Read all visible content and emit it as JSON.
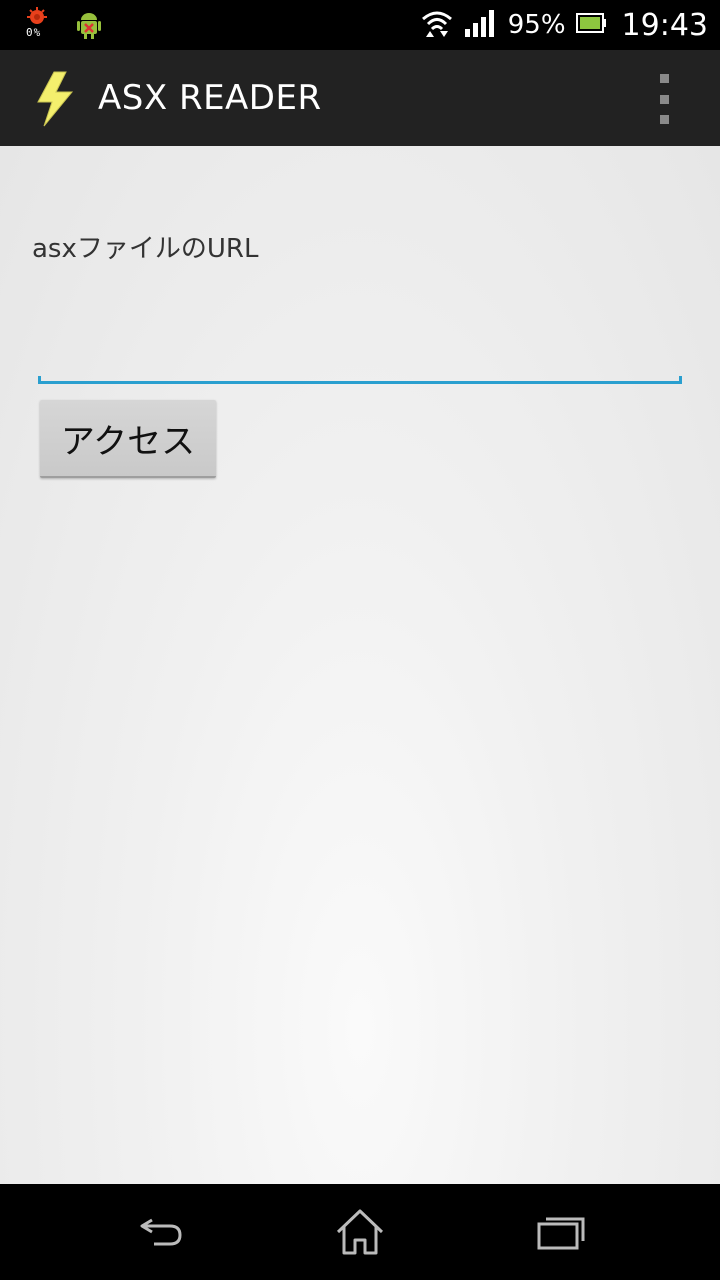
{
  "status_bar": {
    "notification_icons": [
      "download-progress-icon",
      "android-debug-icon"
    ],
    "notification_progress_text": "0%",
    "battery_percent": "95%",
    "time": "19:43",
    "colors": {
      "battery_fill": "#8dc63f",
      "notif_red": "#e8401c",
      "notif_green": "#97c03c"
    }
  },
  "action_bar": {
    "title": "ASX READER",
    "app_icon": "lightning-bolt-icon",
    "menu_icon": "overflow-menu-icon",
    "colors": {
      "background": "#222222",
      "icon_yellow": "#f4ef6d"
    }
  },
  "form": {
    "label": "asxファイルのURL",
    "url_input": {
      "value": "",
      "placeholder": ""
    },
    "submit_label": "アクセス",
    "colors": {
      "input_underline": "#2a9fcf"
    }
  },
  "nav_bar": {
    "buttons": [
      "back-icon",
      "home-icon",
      "recent-apps-icon"
    ]
  }
}
